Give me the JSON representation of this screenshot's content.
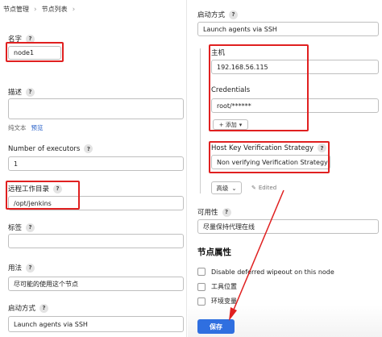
{
  "breadcrumb": {
    "item1": "节点管理",
    "item2": "节点列表"
  },
  "left": {
    "name_label": "名字",
    "name_value": "node1",
    "desc_label": "描述",
    "desc_plain": "纯文本",
    "desc_preview": "预览",
    "executors_label": "Number of executors",
    "executors_value": "1",
    "remote_dir_label": "远程工作目录",
    "remote_dir_value": "/opt/jenkins",
    "tags_label": "标签",
    "tags_value": "",
    "usage_label": "用法",
    "usage_value": "尽可能的使用这个节点",
    "launch_label": "启动方式",
    "launch_value": "Launch agents via SSH"
  },
  "right": {
    "launch_label": "启动方式",
    "launch_value": "Launch agents via SSH",
    "host_label": "主机",
    "host_value": "192.168.56.115",
    "credentials_label": "Credentials",
    "credentials_value": "root/******",
    "add_label": "+ 添加",
    "hkvs_label": "Host Key Verification Strategy",
    "hkvs_value": "Non verifying Verification Strategy",
    "advanced_label": "高级",
    "edited_label": "Edited",
    "availability_label": "可用性",
    "availability_value": "尽量保持代理在线",
    "node_props_title": "节点属性",
    "prop1": "Disable deferred wipeout on this node",
    "prop2": "工具位置",
    "prop3": "环境变量",
    "save_label": "保存"
  },
  "help_glyph": "?",
  "colors": {
    "highlight": "#e02020",
    "primary": "#2f6fe0",
    "link": "#2a62c9"
  }
}
